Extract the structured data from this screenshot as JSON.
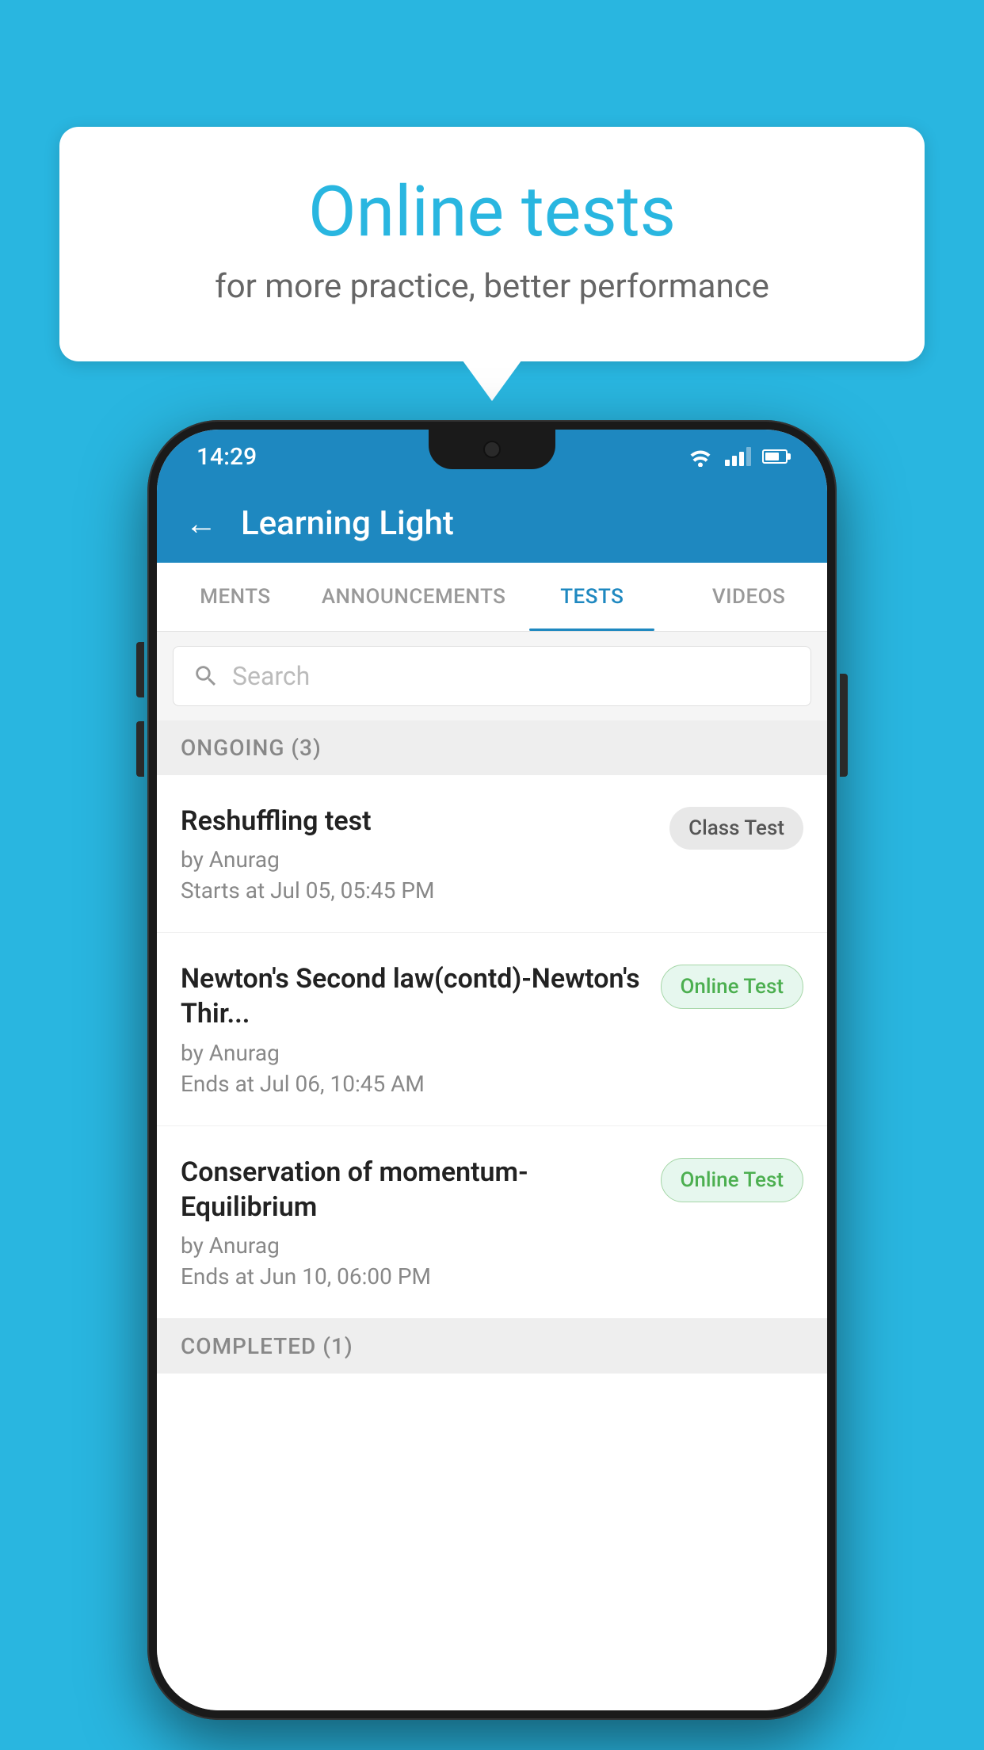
{
  "background": {
    "color": "#29B6E0"
  },
  "hero": {
    "title": "Online tests",
    "subtitle": "for more practice, better performance"
  },
  "phone": {
    "status_bar": {
      "time": "14:29"
    },
    "app_header": {
      "title": "Learning Light",
      "back_label": "←"
    },
    "tabs": [
      {
        "label": "MENTS",
        "active": false
      },
      {
        "label": "ANNOUNCEMENTS",
        "active": false
      },
      {
        "label": "TESTS",
        "active": true
      },
      {
        "label": "VIDEOS",
        "active": false
      }
    ],
    "search": {
      "placeholder": "Search"
    },
    "ongoing_section": {
      "label": "ONGOING (3)"
    },
    "tests": [
      {
        "title": "Reshuffling test",
        "by": "by Anurag",
        "time_label": "Starts at",
        "time": "Jul 05, 05:45 PM",
        "badge": "Class Test",
        "badge_type": "class"
      },
      {
        "title": "Newton's Second law(contd)-Newton's Thir...",
        "by": "by Anurag",
        "time_label": "Ends at",
        "time": "Jul 06, 10:45 AM",
        "badge": "Online Test",
        "badge_type": "online"
      },
      {
        "title": "Conservation of momentum-Equilibrium",
        "by": "by Anurag",
        "time_label": "Ends at",
        "time": "Jun 10, 06:00 PM",
        "badge": "Online Test",
        "badge_type": "online"
      }
    ],
    "completed_section": {
      "label": "COMPLETED (1)"
    }
  }
}
